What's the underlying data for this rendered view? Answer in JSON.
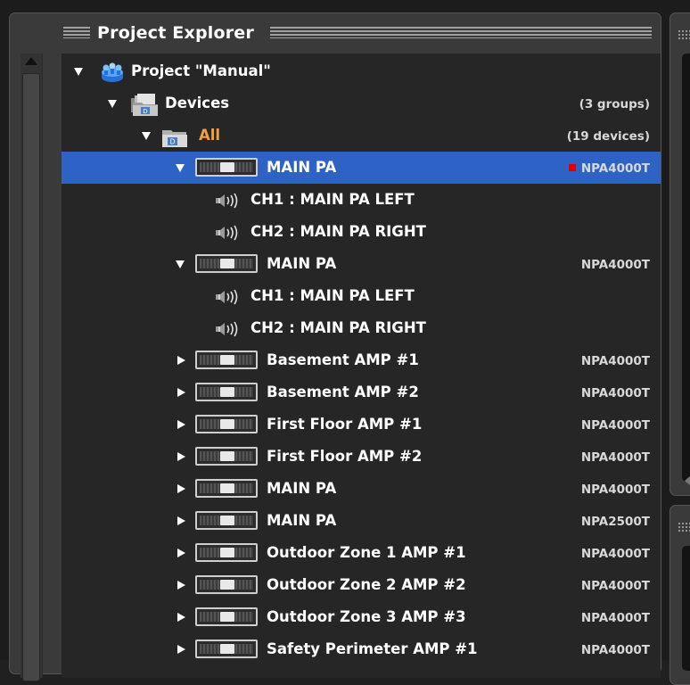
{
  "panel": {
    "title": "Project Explorer"
  },
  "tree": {
    "project": {
      "label": "Project \"Manual\""
    },
    "devices": {
      "label": "Devices",
      "count": "(3 groups)"
    },
    "all": {
      "label": "All",
      "count": "(19 devices)"
    },
    "amps": [
      {
        "label": "MAIN PA",
        "model": "NPA4000T",
        "expanded": true,
        "selected": true,
        "alert": true,
        "channels": [
          "CH1 : MAIN PA LEFT",
          "CH2 : MAIN PA RIGHT"
        ]
      },
      {
        "label": "MAIN PA",
        "model": "NPA4000T",
        "expanded": true,
        "selected": false,
        "alert": false,
        "channels": [
          "CH1 : MAIN PA LEFT",
          "CH2 : MAIN PA RIGHT"
        ]
      },
      {
        "label": "Basement AMP #1",
        "model": "NPA4000T",
        "expanded": false
      },
      {
        "label": "Basement AMP #2",
        "model": "NPA4000T",
        "expanded": false
      },
      {
        "label": "First Floor AMP #1",
        "model": "NPA4000T",
        "expanded": false
      },
      {
        "label": "First Floor AMP #2",
        "model": "NPA4000T",
        "expanded": false
      },
      {
        "label": "MAIN PA",
        "model": "NPA4000T",
        "expanded": false
      },
      {
        "label": "MAIN PA",
        "model": "NPA2500T",
        "expanded": false
      },
      {
        "label": "Outdoor Zone 1 AMP #1",
        "model": "NPA4000T",
        "expanded": false
      },
      {
        "label": "Outdoor Zone 2 AMP #2",
        "model": "NPA4000T",
        "expanded": false
      },
      {
        "label": "Outdoor Zone 3 AMP #3",
        "model": "NPA4000T",
        "expanded": false
      },
      {
        "label": "Safety Perimeter AMP #1",
        "model": "NPA4000T",
        "expanded": false
      }
    ]
  },
  "colors": {
    "selection": "#2e62c4",
    "alert": "#e00000",
    "all_label": "#f0a040"
  },
  "icons": [
    "project-icon",
    "devices-folder-icon",
    "all-folder-icon",
    "amplifier-icon",
    "speaker-icon",
    "expand-arrow-icon",
    "collapse-arrow-icon"
  ]
}
